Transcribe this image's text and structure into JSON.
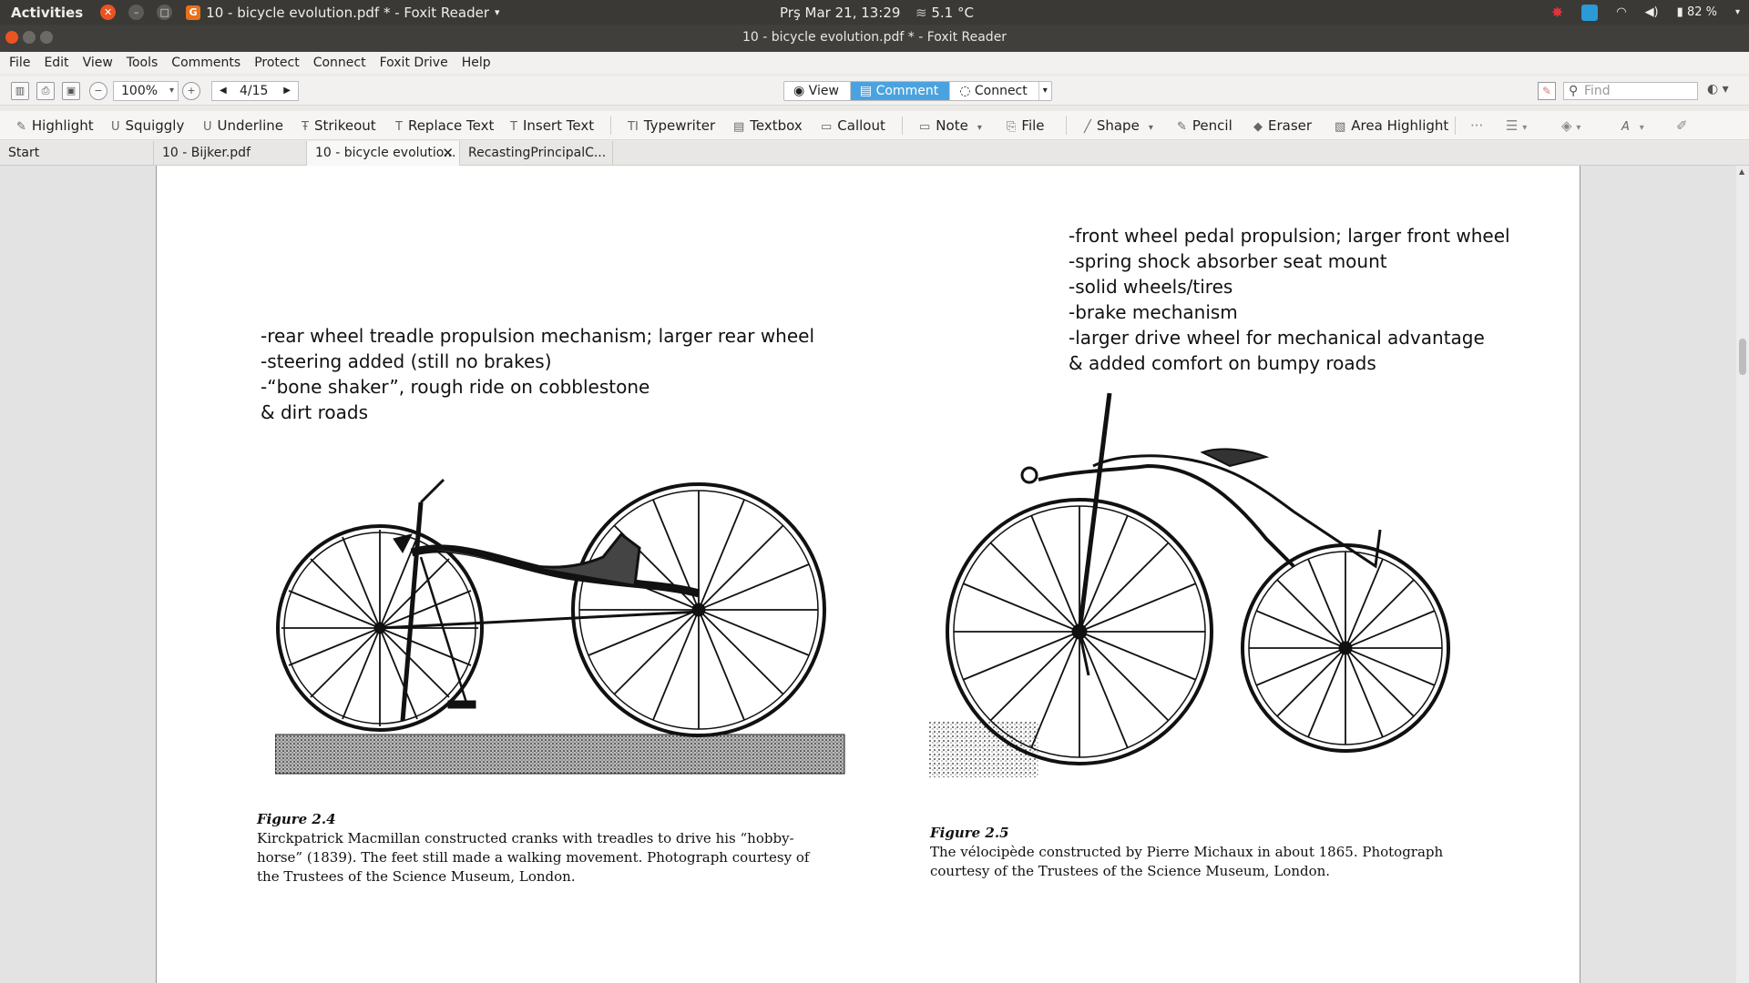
{
  "topbar": {
    "activities": "Activities",
    "app_title": "10 - bicycle evolution.pdf * - Foxit Reader",
    "app_title_arrow": "▾",
    "clock": "Prş Mar 21, 13:29",
    "temperature": "5.1 °C",
    "battery": "82 %"
  },
  "window": {
    "title": "10 - bicycle evolution.pdf * - Foxit Reader"
  },
  "menu": [
    "File",
    "Edit",
    "View",
    "Tools",
    "Comments",
    "Protect",
    "Connect",
    "Foxit Drive",
    "Help"
  ],
  "toolbar": {
    "zoom": "100%",
    "page": "4/15",
    "modes": [
      "View",
      "Comment",
      "Connect"
    ],
    "active_mode": "Comment",
    "find_placeholder": "Find"
  },
  "comment_tools": [
    "Highlight",
    "Squiggly",
    "Underline",
    "Strikeout",
    "Replace Text",
    "Insert Text",
    "Typewriter",
    "Textbox",
    "Callout",
    "Note",
    "File",
    "Shape",
    "Pencil",
    "Eraser",
    "Area Highlight"
  ],
  "tabs": [
    "Start",
    "10 - Bijker.pdf",
    "10 - bicycle evolutio...",
    "RecastingPrincipalC..."
  ],
  "active_tab": 2,
  "document": {
    "left_notes": [
      "-rear wheel treadle propulsion mechanism; larger rear wheel",
      "-steering added (still no brakes)",
      "-“bone shaker”, rough ride on cobblestone",
      "& dirt roads"
    ],
    "right_notes": [
      "-front wheel pedal propulsion; larger front wheel",
      "-spring shock absorber seat mount",
      "-solid wheels/tires",
      "-brake mechanism",
      "-larger drive wheel for mechanical advantage",
      "& added comfort on bumpy roads"
    ],
    "fig24": {
      "title": "Figure 2.4",
      "lines": [
        "Kirckpatrick Macmillan constructed cranks with treadles to drive his “hobby-",
        "horse” (1839). The feet still made a walking movement. Photograph courtesy of",
        "the Trustees of the Science Museum, London."
      ]
    },
    "fig25": {
      "title": "Figure 2.5",
      "lines": [
        "The vélocipède constructed by Pierre Michaux in about 1865. Photograph",
        "courtesy of the Trustees of the Science Museum, London."
      ]
    }
  }
}
